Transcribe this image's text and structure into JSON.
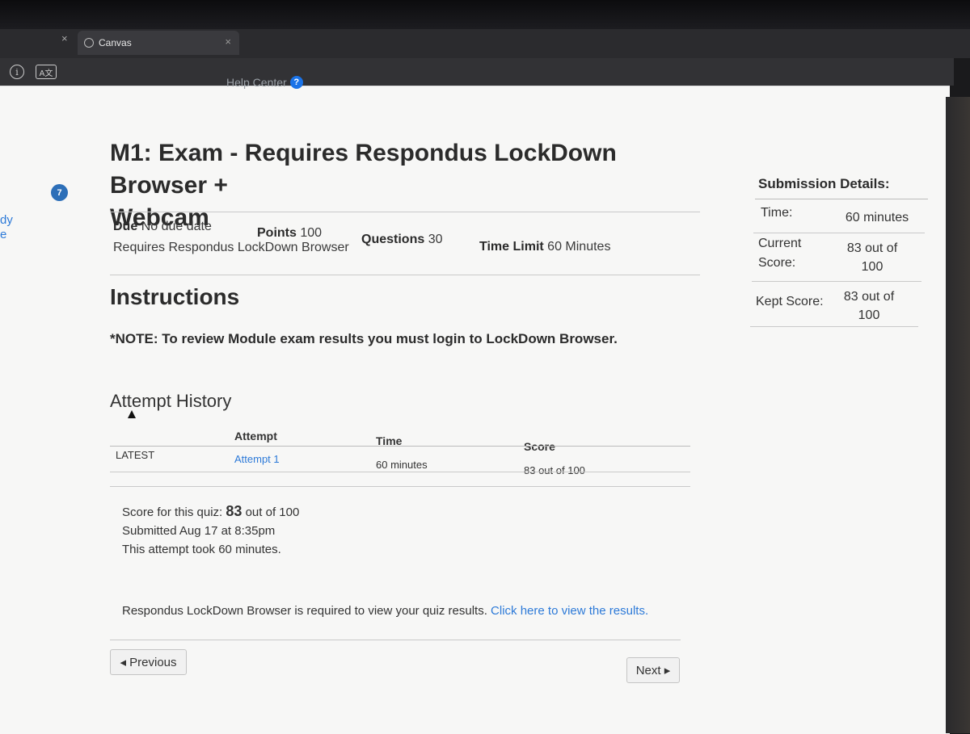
{
  "browser": {
    "tab_title": "Canvas",
    "tab_close_glyph": "×",
    "prev_tab_close_glyph": "×",
    "info_icon_glyph": "i",
    "translate_icon_glyph": "A文",
    "help_center_label": "Help Center",
    "help_center_icon_glyph": "?"
  },
  "sidebar": {
    "edge_text_line1": "dy",
    "edge_text_line2": "e",
    "badge_count": "7"
  },
  "quiz": {
    "title_line1": "M1: Exam - Requires Respondus LockDown Browser +",
    "title_line2": "Webcam",
    "due_label": "Due",
    "due_value": "No due date",
    "points_label": "Points",
    "points_value": "100",
    "questions_label": "Questions",
    "questions_value": "30",
    "time_limit_label": "Time Limit",
    "time_limit_value": "60 Minutes",
    "requires_text": "Requires Respondus LockDown Browser",
    "instructions_heading": "Instructions",
    "note_text": "*NOTE: To review Module exam results you must login to LockDown Browser."
  },
  "attempt_history": {
    "heading": "Attempt History",
    "columns": {
      "attempt": "Attempt",
      "time": "Time",
      "score": "Score"
    },
    "rows": [
      {
        "label": "LATEST",
        "attempt": "Attempt 1",
        "time": "60 minutes",
        "score": "83 out of 100"
      }
    ]
  },
  "summary": {
    "score_prefix": "Score for this quiz:",
    "score_value": "83",
    "score_suffix": "out of 100",
    "submitted": "Submitted Aug 17 at 8:35pm",
    "took": "This attempt took 60 minutes."
  },
  "lockdown_notice": {
    "text": "Respondus LockDown Browser is required to view your quiz results.",
    "link": "Click here to view the results."
  },
  "nav": {
    "previous_label": "◂ Previous",
    "next_label": "Next ▸"
  },
  "submission_details": {
    "heading": "Submission Details:",
    "time_label": "Time:",
    "time_value": "60 minutes",
    "current_label_line1": "Current",
    "current_label_line2": "Score:",
    "current_value_line1": "83 out of",
    "current_value_line2": "100",
    "kept_label": "Kept Score:",
    "kept_value_line1": "83 out of",
    "kept_value_line2": "100"
  }
}
